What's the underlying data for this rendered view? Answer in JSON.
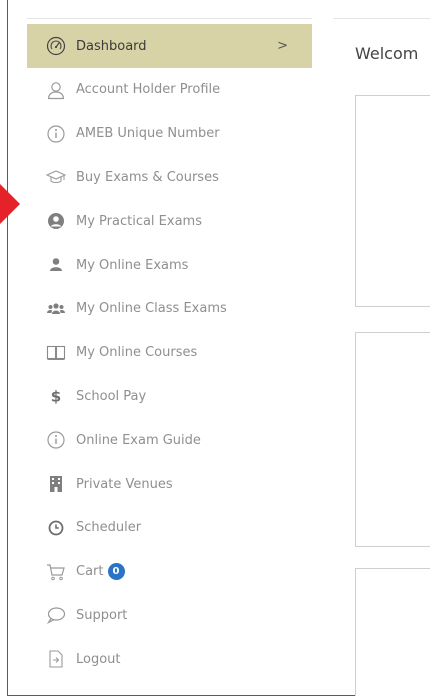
{
  "sidebar": {
    "items": [
      {
        "label": "Dashboard",
        "icon": "dashboard-gauge-icon",
        "active": true
      },
      {
        "label": "Account Holder Profile",
        "icon": "user-outline-icon"
      },
      {
        "label": "AMEB Unique Number",
        "icon": "info-circle-icon"
      },
      {
        "label": "Buy Exams & Courses",
        "icon": "graduation-cap-icon"
      },
      {
        "label": "My Practical Exams",
        "icon": "user-circle-icon"
      },
      {
        "label": "My Online Exams",
        "icon": "user-solid-icon"
      },
      {
        "label": "My Online Class Exams",
        "icon": "users-group-icon"
      },
      {
        "label": "My Online Courses",
        "icon": "open-book-icon"
      },
      {
        "label": "School Pay",
        "icon": "dollar-icon"
      },
      {
        "label": "Online Exam Guide",
        "icon": "info-circle-icon"
      },
      {
        "label": "Private Venues",
        "icon": "building-icon"
      },
      {
        "label": "Scheduler",
        "icon": "clock-icon"
      },
      {
        "label": "Cart",
        "icon": "cart-icon",
        "badge": "0"
      },
      {
        "label": "Support",
        "icon": "chat-bubble-icon"
      },
      {
        "label": "Logout",
        "icon": "logout-icon"
      }
    ],
    "active_chevron": ">"
  },
  "main": {
    "welcome": "Welcom"
  },
  "colors": {
    "active_bg": "#d8d3a6",
    "badge": "#2b74c5",
    "annotation_red": "#d6252f"
  }
}
